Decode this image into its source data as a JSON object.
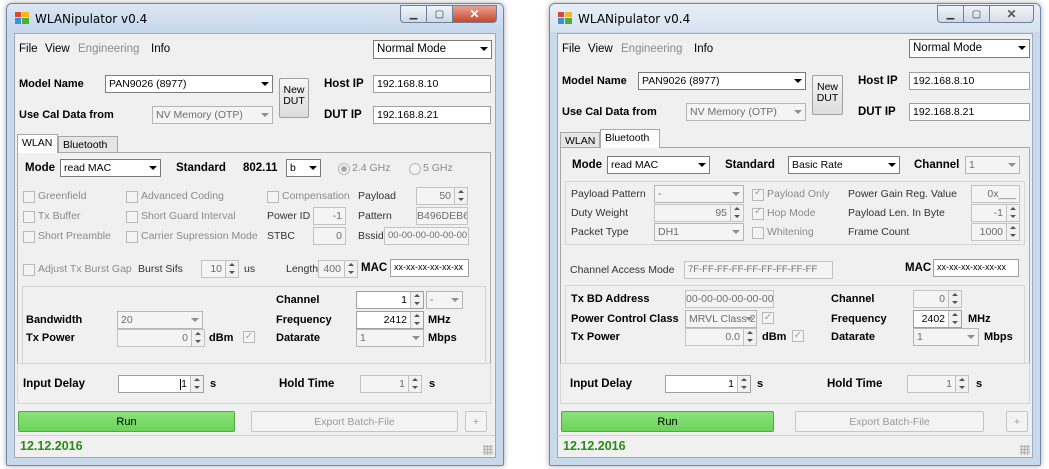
{
  "app": {
    "title": "WLANipulator v0.4",
    "mode": "Normal Mode",
    "date": "12.12.2016"
  },
  "menu": {
    "file": "File",
    "view": "View",
    "engineering": "Engineering",
    "info": "Info"
  },
  "model": {
    "label": "Model Name",
    "value": "PAN9026 (8977)",
    "new_dut_1": "New",
    "new_dut_2": "DUT"
  },
  "cal": {
    "label": "Use Cal Data from",
    "value": "NV Memory (OTP)"
  },
  "ip": {
    "host_label": "Host IP",
    "host_value": "192.168.8.10",
    "dut_label": "DUT IP",
    "dut_value": "192.168.8.21"
  },
  "tabs": {
    "wlan": "WLAN",
    "bluetooth": "Bluetooth"
  },
  "wlan": {
    "mode_label": "Mode",
    "mode_value": "read MAC",
    "standard_label": "Standard",
    "standard_text": "802.11",
    "standard_value": "b",
    "band_24": "2.4 GHz",
    "band_5": "5 GHz",
    "greenfield": "Greenfield",
    "advanced_coding": "Advanced Coding",
    "compensation": "Compensation",
    "payload_label": "Payload",
    "payload_value": "50",
    "tx_buffer": "Tx Buffer",
    "short_gi": "Short Guard Interval",
    "power_id_label": "Power ID",
    "power_id_value": "-1",
    "pattern_label": "Pattern",
    "pattern_value": "B496DEB6",
    "short_preamble": "Short Preamble",
    "carrier_supp": "Carrier Supression Mode",
    "stbc_label": "STBC",
    "stbc_value": "0",
    "bssid_label": "Bssid",
    "bssid_value": "00-00-00-00-00-00",
    "adjust_tx": "Adjust Tx Burst Gap",
    "burst_sifs_label": "Burst Sifs",
    "burst_sifs_value": "10",
    "us": "us",
    "length_label": "Length",
    "length_value": "400",
    "mac_label": "MAC",
    "mac_value": "xx-xx-xx-xx-xx-xx",
    "channel_label": "Channel",
    "channel_value": "1",
    "channel_sub": "-",
    "bandwidth_label": "Bandwidth",
    "bandwidth_value": "20",
    "frequency_label": "Frequency",
    "frequency_value": "2412",
    "mhz": "MHz",
    "txpower_label": "Tx Power",
    "txpower_value": "0",
    "dbm": "dBm",
    "datarate_label": "Datarate",
    "datarate_value": "1",
    "mbps": "Mbps",
    "input_delay_label": "Input Delay",
    "input_delay_value": "1",
    "s": "s",
    "hold_time_label": "Hold Time",
    "hold_time_value": "1",
    "run": "Run",
    "export": "Export Batch-File",
    "plus": "+"
  },
  "bt": {
    "mode_label": "Mode",
    "mode_value": "read MAC",
    "standard_label": "Standard",
    "standard_value": "Basic Rate",
    "channel_label": "Channel",
    "channel_value": "1",
    "payload_pattern_label": "Payload Pattern",
    "payload_pattern_value": "-",
    "payload_only": "Payload Only",
    "power_gain_label": "Power Gain Reg. Value",
    "power_gain_value": "0x___",
    "duty_weight_label": "Duty Weight",
    "duty_weight_value": "95",
    "hop_mode": "Hop Mode",
    "payload_len_label": "Payload Len. In Byte",
    "payload_len_value": "-1",
    "packet_type_label": "Packet Type",
    "packet_type_value": "DH1",
    "whitening": "Whitening",
    "frame_count_label": "Frame Count",
    "frame_count_value": "1000",
    "access_mode_label": "Channel Access Mode",
    "access_mode_value": "7F-FF-FF-FF-FF-FF-FF-FF-FF",
    "mac_label": "MAC",
    "mac_value": "xx-xx-xx-xx-xx-xx",
    "tx_bd_label": "Tx BD Address",
    "tx_bd_value": "00-00-00-00-00-00",
    "channel2_label": "Channel",
    "channel2_value": "0",
    "power_class_label": "Power Control Class",
    "power_class_value": "MRVL Class 2",
    "frequency_label": "Frequency",
    "frequency_value": "2402",
    "mhz": "MHz",
    "txpower_label": "Tx Power",
    "txpower_value": "0.0",
    "dbm": "dBm",
    "datarate_label": "Datarate",
    "datarate_value": "1",
    "mbps": "Mbps",
    "input_delay_label": "Input Delay",
    "input_delay_value": "1",
    "s": "s",
    "hold_time_label": "Hold Time",
    "hold_time_value": "1",
    "run": "Run",
    "export": "Export Batch-File",
    "plus": "+"
  }
}
